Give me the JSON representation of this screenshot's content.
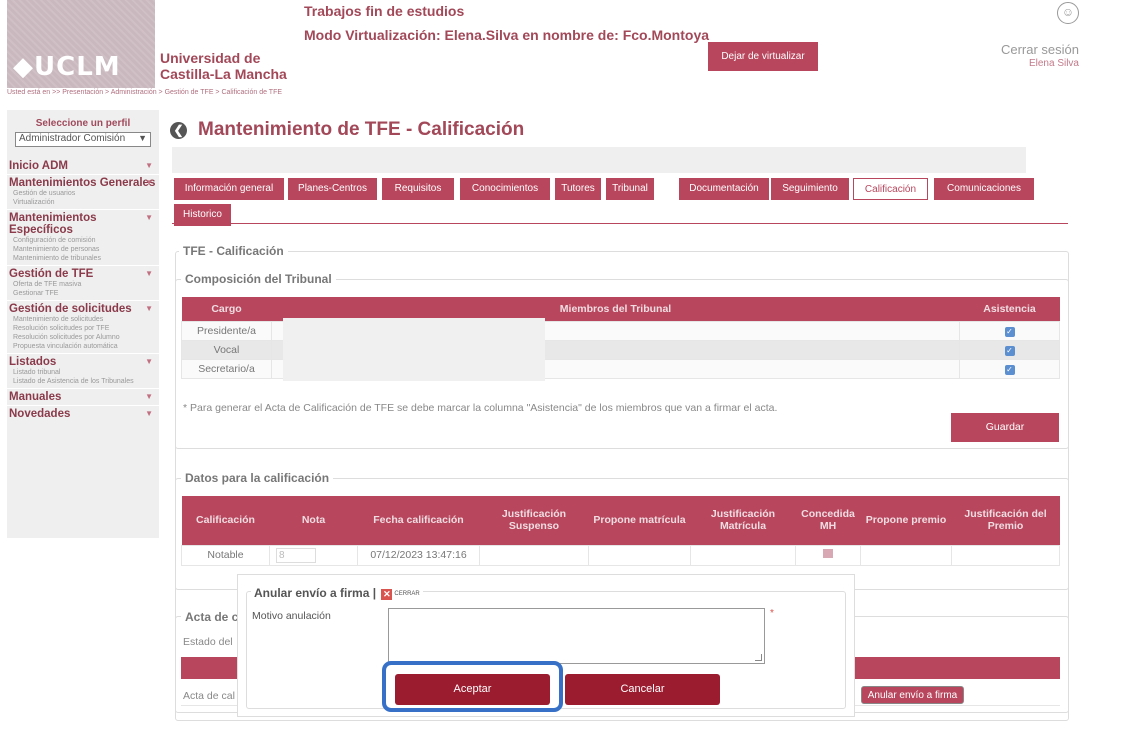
{
  "header": {
    "logo_text": "◆UCLM",
    "univ_line1": "Universidad de",
    "univ_line2": "Castilla-La Mancha",
    "title_line1": "Trabajos fin de estudios",
    "title_line2": "Modo Virtualización: Elena.Silva en nombre de: Fco.Montoya",
    "devirtualize_label": "Dejar de virtualizar",
    "logout_label": "Cerrar sesión",
    "user_name": "Elena Silva"
  },
  "breadcrumb": "Usted está en >> Presentación > Administración > Gestión de TFE > Calificación de TFE",
  "sidebar": {
    "profile_label": "Seleccione un perfil",
    "profile_value": "Administrador Comisión",
    "sections": [
      {
        "title": "Inicio ADM",
        "items": []
      },
      {
        "title": "Mantenimientos Generales",
        "items": [
          "Gestión de usuarios",
          "Virtualización"
        ]
      },
      {
        "title": "Mantenimientos Específicos",
        "items": [
          "Configuración de comisión",
          "Mantenimiento de personas",
          "Mantenimiento de tribunales"
        ]
      },
      {
        "title": "Gestión de TFE",
        "items": [
          "Oferta de TFE masiva",
          "Gestionar TFE"
        ]
      },
      {
        "title": "Gestión de solicitudes",
        "items": [
          "Mantenimiento de solicitudes",
          "Resolución solicitudes por TFE",
          "Resolución solicitudes por Alumno",
          "Propuesta vinculación automática"
        ]
      },
      {
        "title": "Listados",
        "items": [
          "Listado tribunal",
          "Listado de Asistencia de los Tribunales"
        ]
      },
      {
        "title": "Manuales",
        "items": []
      },
      {
        "title": "Novedades",
        "items": []
      }
    ]
  },
  "page": {
    "title": "Mantenimiento de TFE - Calificación",
    "tabs": [
      "Información general",
      "Planes-Centros",
      "Requisitos",
      "Conocimientos",
      "Tutores",
      "Tribunal",
      "Documentación",
      "Seguimiento",
      "Calificación",
      "Comunicaciones",
      "Historico"
    ],
    "active_tab": "Calificación"
  },
  "calificacion": {
    "legend": "TFE - Calificación",
    "tribunal_legend": "Composición del Tribunal",
    "tribunal_headers": [
      "Cargo",
      "Miembros del Tribunal",
      "Asistencia"
    ],
    "tribunal_rows": [
      "Presidente/a",
      "Vocal",
      "Secretario/a"
    ],
    "note": "* Para generar el Acta de Calificación de TFE se debe marcar la columna \"Asistencia\" de los miembros que van a firmar el acta.",
    "save_label": "Guardar",
    "datos_legend": "Datos para la calificación",
    "datos_headers": [
      "Calificación",
      "Nota",
      "Fecha calificación",
      "Justificación Suspenso",
      "Propone matrícula",
      "Justificación Matrícula",
      "Concedida MH",
      "Propone premio",
      "Justificación del Premio"
    ],
    "datos_row": {
      "calificacion": "Notable",
      "nota": "8",
      "fecha": "07/12/2023 13:47:16"
    },
    "acta_legend": "Acta de c",
    "acta_estado": "Estado del",
    "acta_row_label": "Acta de cal",
    "anular_label": "Anular envío a firma"
  },
  "modal": {
    "title": "Anular envío a firma |",
    "close_label": "CERRAR",
    "field_label": "Motivo anulación",
    "required_mark": "*",
    "accept_label": "Aceptar",
    "cancel_label": "Cancelar"
  }
}
